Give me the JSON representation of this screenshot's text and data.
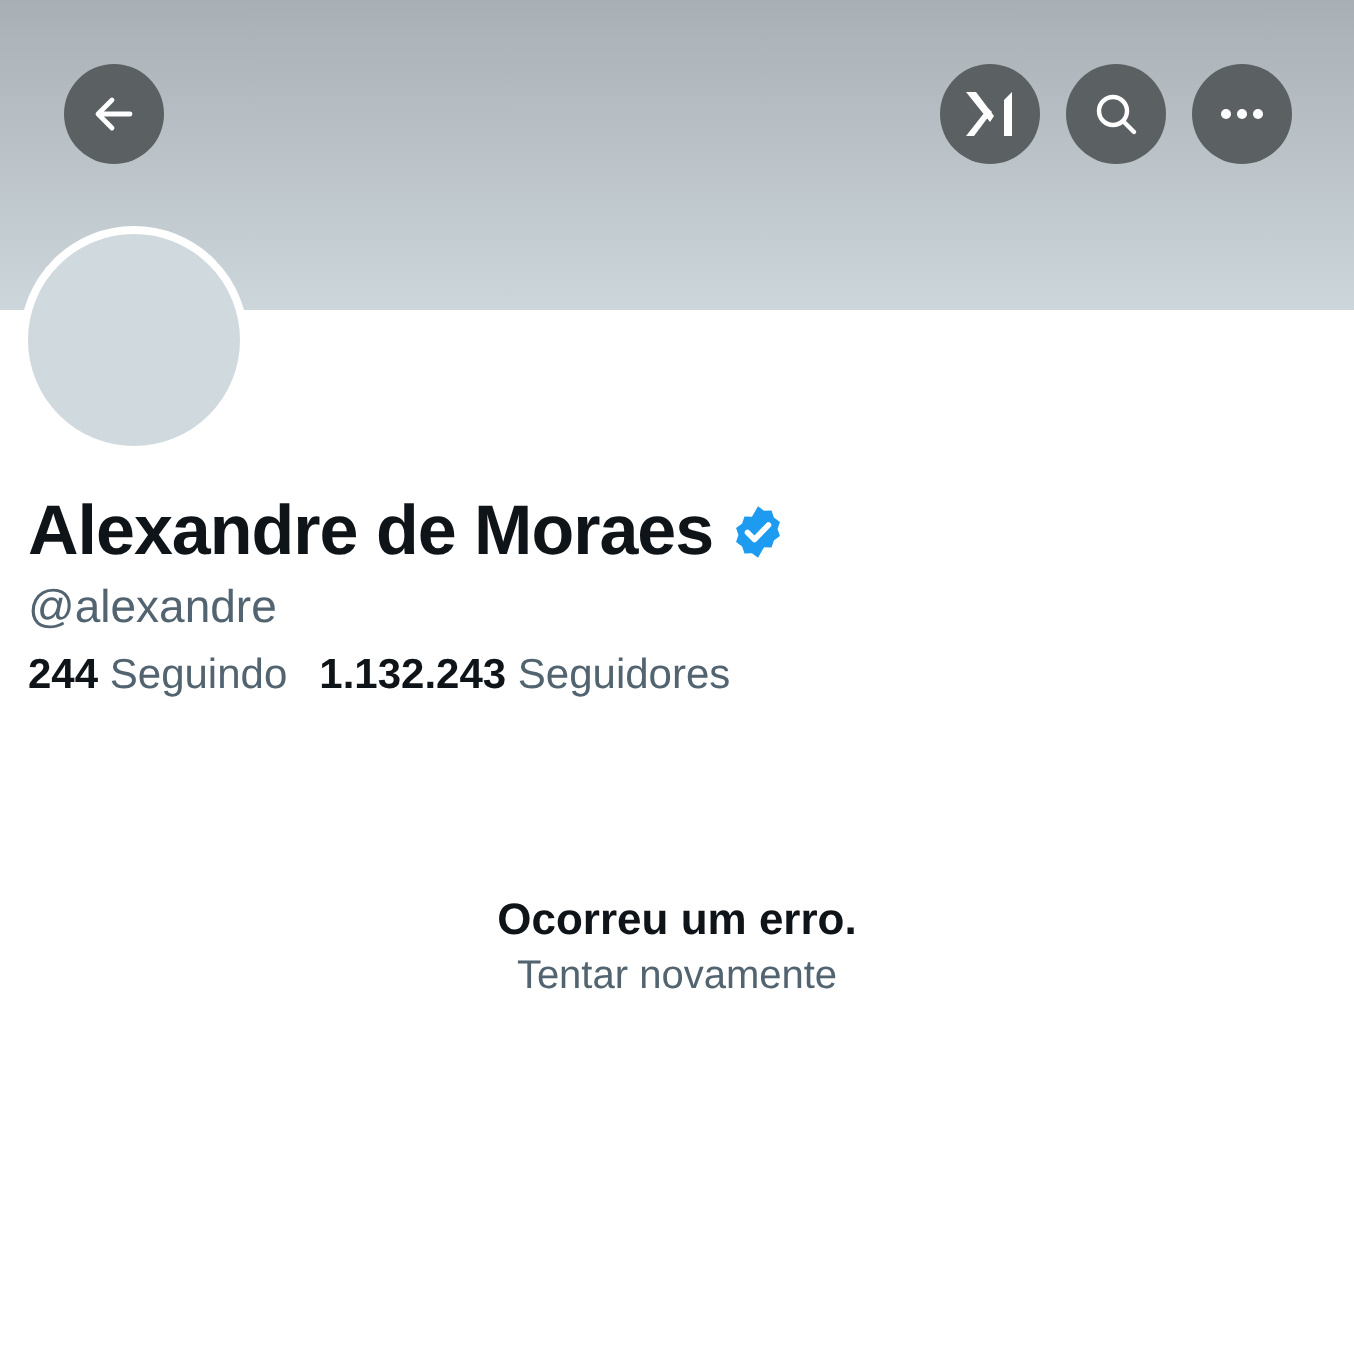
{
  "profile": {
    "name": "Alexandre de Moraes",
    "verified": true,
    "handle": "@alexandre",
    "stats": [
      {
        "count": "244",
        "label": "Seguindo"
      },
      {
        "count": "1.132.243",
        "label": "Seguidores"
      }
    ]
  },
  "error": {
    "title": "Ocorreu um erro.",
    "retry": "Tentar novamente"
  }
}
